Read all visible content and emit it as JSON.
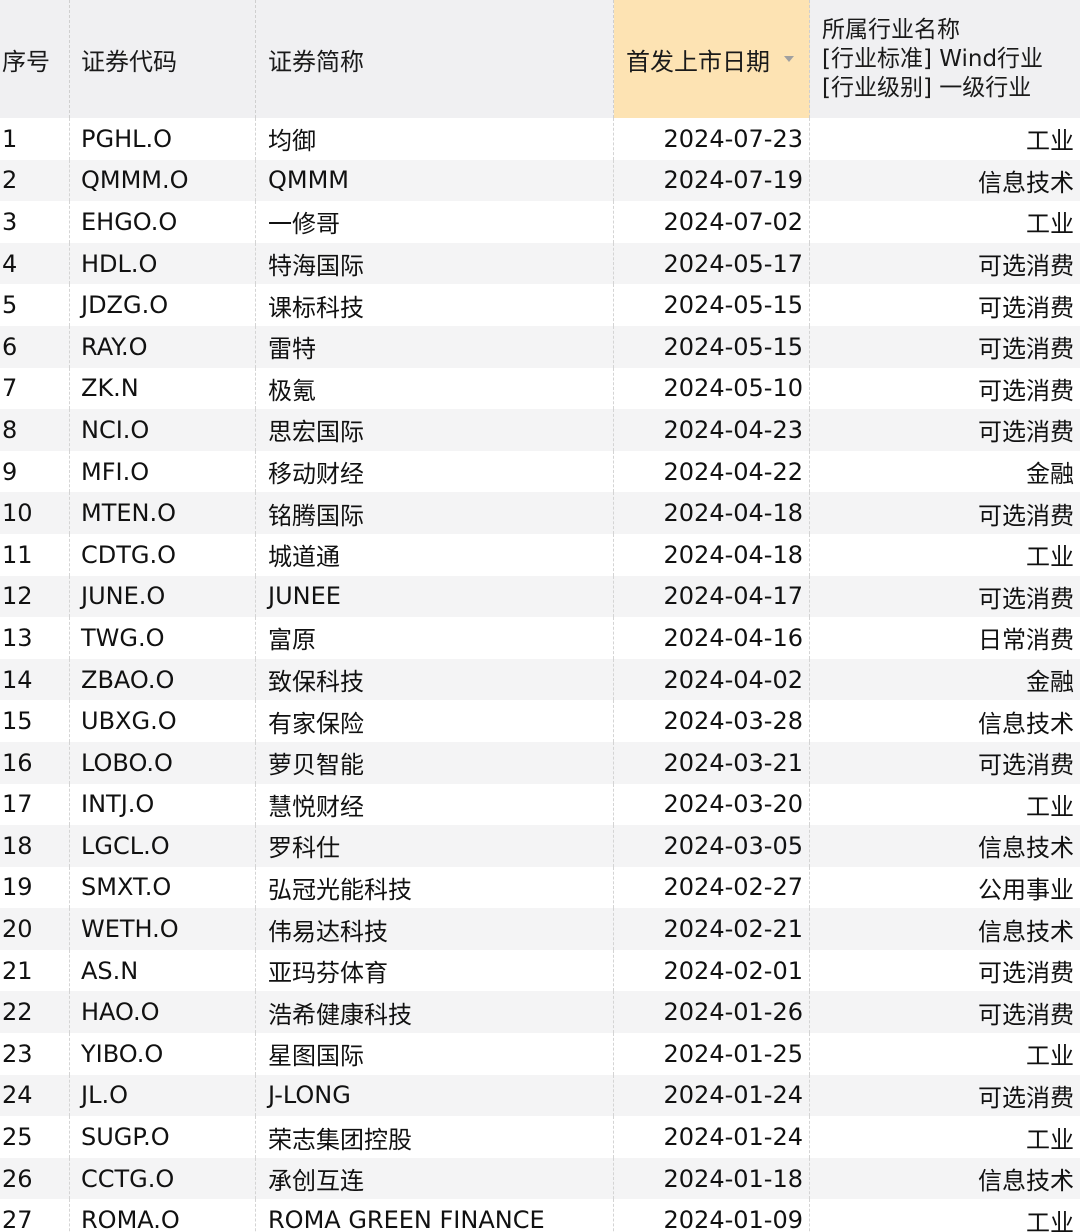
{
  "table": {
    "headers": {
      "index": "序号",
      "code": "证券代码",
      "name": "证券简称",
      "ipo_date": "首发上市日期",
      "industry_line1": "所属行业名称",
      "industry_line2": "[行业标准] Wind行业",
      "industry_line3": "[行业级别] 一级行业"
    },
    "sort": {
      "column": "ipo_date",
      "direction": "descending",
      "icon": "sort-down-triangle-icon"
    },
    "colors": {
      "header_bg": "#f0f0f2",
      "active_header_bg": "#fde3b3",
      "stripe_bg": "#f4f4f5"
    },
    "rows": [
      {
        "index": "1",
        "code": "PGHL.O",
        "name": "均御",
        "ipo_date": "2024-07-23",
        "industry": "工业"
      },
      {
        "index": "2",
        "code": "QMMM.O",
        "name": "QMMM",
        "ipo_date": "2024-07-19",
        "industry": "信息技术"
      },
      {
        "index": "3",
        "code": "EHGO.O",
        "name": "一修哥",
        "ipo_date": "2024-07-02",
        "industry": "工业"
      },
      {
        "index": "4",
        "code": "HDL.O",
        "name": "特海国际",
        "ipo_date": "2024-05-17",
        "industry": "可选消费"
      },
      {
        "index": "5",
        "code": "JDZG.O",
        "name": "课标科技",
        "ipo_date": "2024-05-15",
        "industry": "可选消费"
      },
      {
        "index": "6",
        "code": "RAY.O",
        "name": "雷特",
        "ipo_date": "2024-05-15",
        "industry": "可选消费"
      },
      {
        "index": "7",
        "code": "ZK.N",
        "name": "极氪",
        "ipo_date": "2024-05-10",
        "industry": "可选消费"
      },
      {
        "index": "8",
        "code": "NCI.O",
        "name": "思宏国际",
        "ipo_date": "2024-04-23",
        "industry": "可选消费"
      },
      {
        "index": "9",
        "code": "MFI.O",
        "name": "移动财经",
        "ipo_date": "2024-04-22",
        "industry": "金融"
      },
      {
        "index": "10",
        "code": "MTEN.O",
        "name": "铭腾国际",
        "ipo_date": "2024-04-18",
        "industry": "可选消费"
      },
      {
        "index": "11",
        "code": "CDTG.O",
        "name": "城道通",
        "ipo_date": "2024-04-18",
        "industry": "工业"
      },
      {
        "index": "12",
        "code": "JUNE.O",
        "name": "JUNEE",
        "ipo_date": "2024-04-17",
        "industry": "可选消费"
      },
      {
        "index": "13",
        "code": "TWG.O",
        "name": "富原",
        "ipo_date": "2024-04-16",
        "industry": "日常消费"
      },
      {
        "index": "14",
        "code": "ZBAO.O",
        "name": "致保科技",
        "ipo_date": "2024-04-02",
        "industry": "金融"
      },
      {
        "index": "15",
        "code": "UBXG.O",
        "name": "有家保险",
        "ipo_date": "2024-03-28",
        "industry": "信息技术"
      },
      {
        "index": "16",
        "code": "LOBO.O",
        "name": "萝贝智能",
        "ipo_date": "2024-03-21",
        "industry": "可选消费"
      },
      {
        "index": "17",
        "code": "INTJ.O",
        "name": "慧悦财经",
        "ipo_date": "2024-03-20",
        "industry": "工业"
      },
      {
        "index": "18",
        "code": "LGCL.O",
        "name": "罗科仕",
        "ipo_date": "2024-03-05",
        "industry": "信息技术"
      },
      {
        "index": "19",
        "code": "SMXT.O",
        "name": "弘冠光能科技",
        "ipo_date": "2024-02-27",
        "industry": "公用事业"
      },
      {
        "index": "20",
        "code": "WETH.O",
        "name": "伟易达科技",
        "ipo_date": "2024-02-21",
        "industry": "信息技术"
      },
      {
        "index": "21",
        "code": "AS.N",
        "name": "亚玛芬体育",
        "ipo_date": "2024-02-01",
        "industry": "可选消费"
      },
      {
        "index": "22",
        "code": "HAO.O",
        "name": "浩希健康科技",
        "ipo_date": "2024-01-26",
        "industry": "可选消费"
      },
      {
        "index": "23",
        "code": "YIBO.O",
        "name": "星图国际",
        "ipo_date": "2024-01-25",
        "industry": "工业"
      },
      {
        "index": "24",
        "code": "JL.O",
        "name": "J-LONG",
        "ipo_date": "2024-01-24",
        "industry": "可选消费"
      },
      {
        "index": "25",
        "code": "SUGP.O",
        "name": "荣志集团控股",
        "ipo_date": "2024-01-24",
        "industry": "工业"
      },
      {
        "index": "26",
        "code": "CCTG.O",
        "name": "承创互连",
        "ipo_date": "2024-01-18",
        "industry": "信息技术"
      },
      {
        "index": "27",
        "code": "ROMA.O",
        "name": "ROMA GREEN FINANCE",
        "ipo_date": "2024-01-09",
        "industry": "工业"
      }
    ]
  }
}
